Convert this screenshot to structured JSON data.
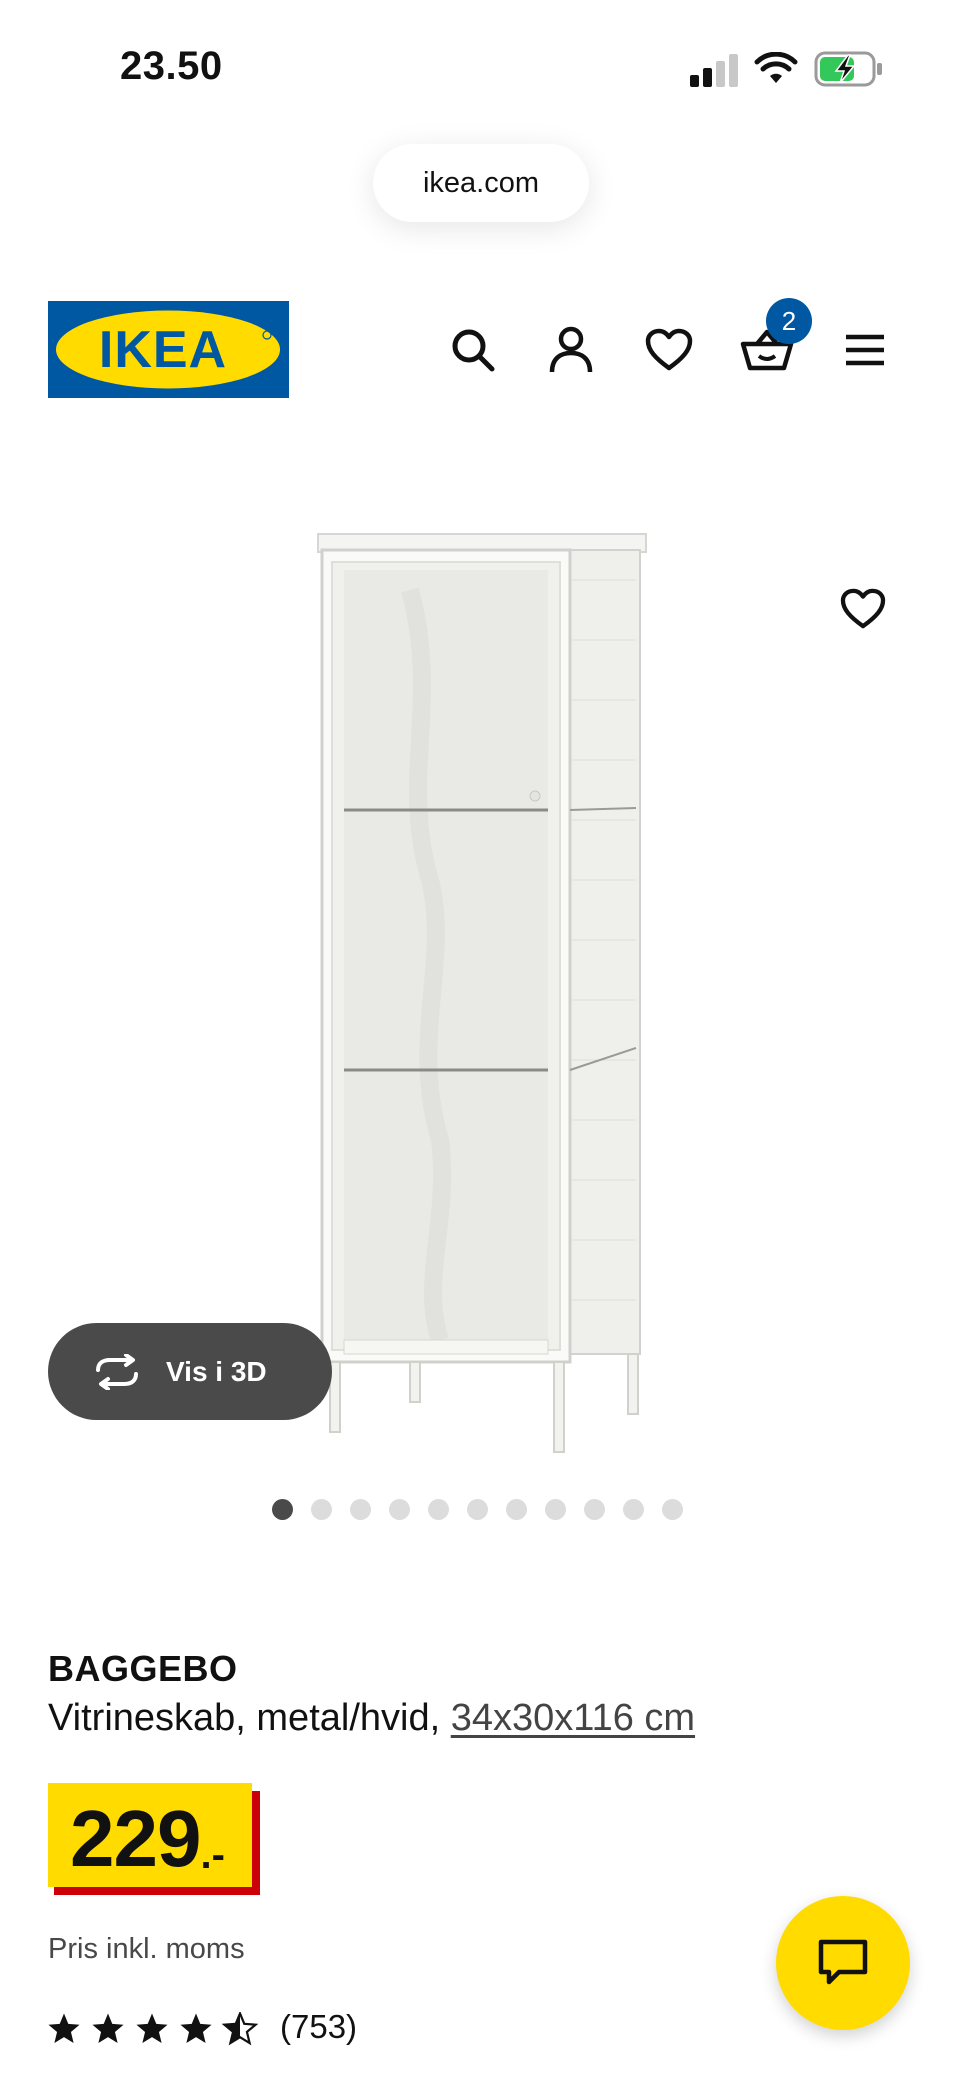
{
  "status_bar": {
    "time": "23.50"
  },
  "browser": {
    "url": "ikea.com"
  },
  "header": {
    "logo_text": "IKEA",
    "cart_count": "2",
    "colors": {
      "logo_blue": "#0058a3",
      "logo_yellow": "#ffdb00"
    },
    "icons": [
      "search-icon",
      "user-icon",
      "heart-icon",
      "cart-icon",
      "menu-icon"
    ]
  },
  "gallery": {
    "view_3d_label": "Vis i 3D",
    "total_images": 11,
    "active_index": 0
  },
  "product": {
    "name": "BAGGEBO",
    "description": "Vitrineskab, metal/hvid,",
    "size_link": "34x30x116 cm",
    "price_integer": "229",
    "price_suffix": ".-",
    "vat_note": "Pris inkl. moms",
    "rating": 4.5,
    "rating_count": "(753)",
    "colors": {
      "price_bg": "#ffdb00",
      "price_shadow": "#cc0008"
    }
  },
  "chat": {
    "icon": "chat-icon"
  }
}
